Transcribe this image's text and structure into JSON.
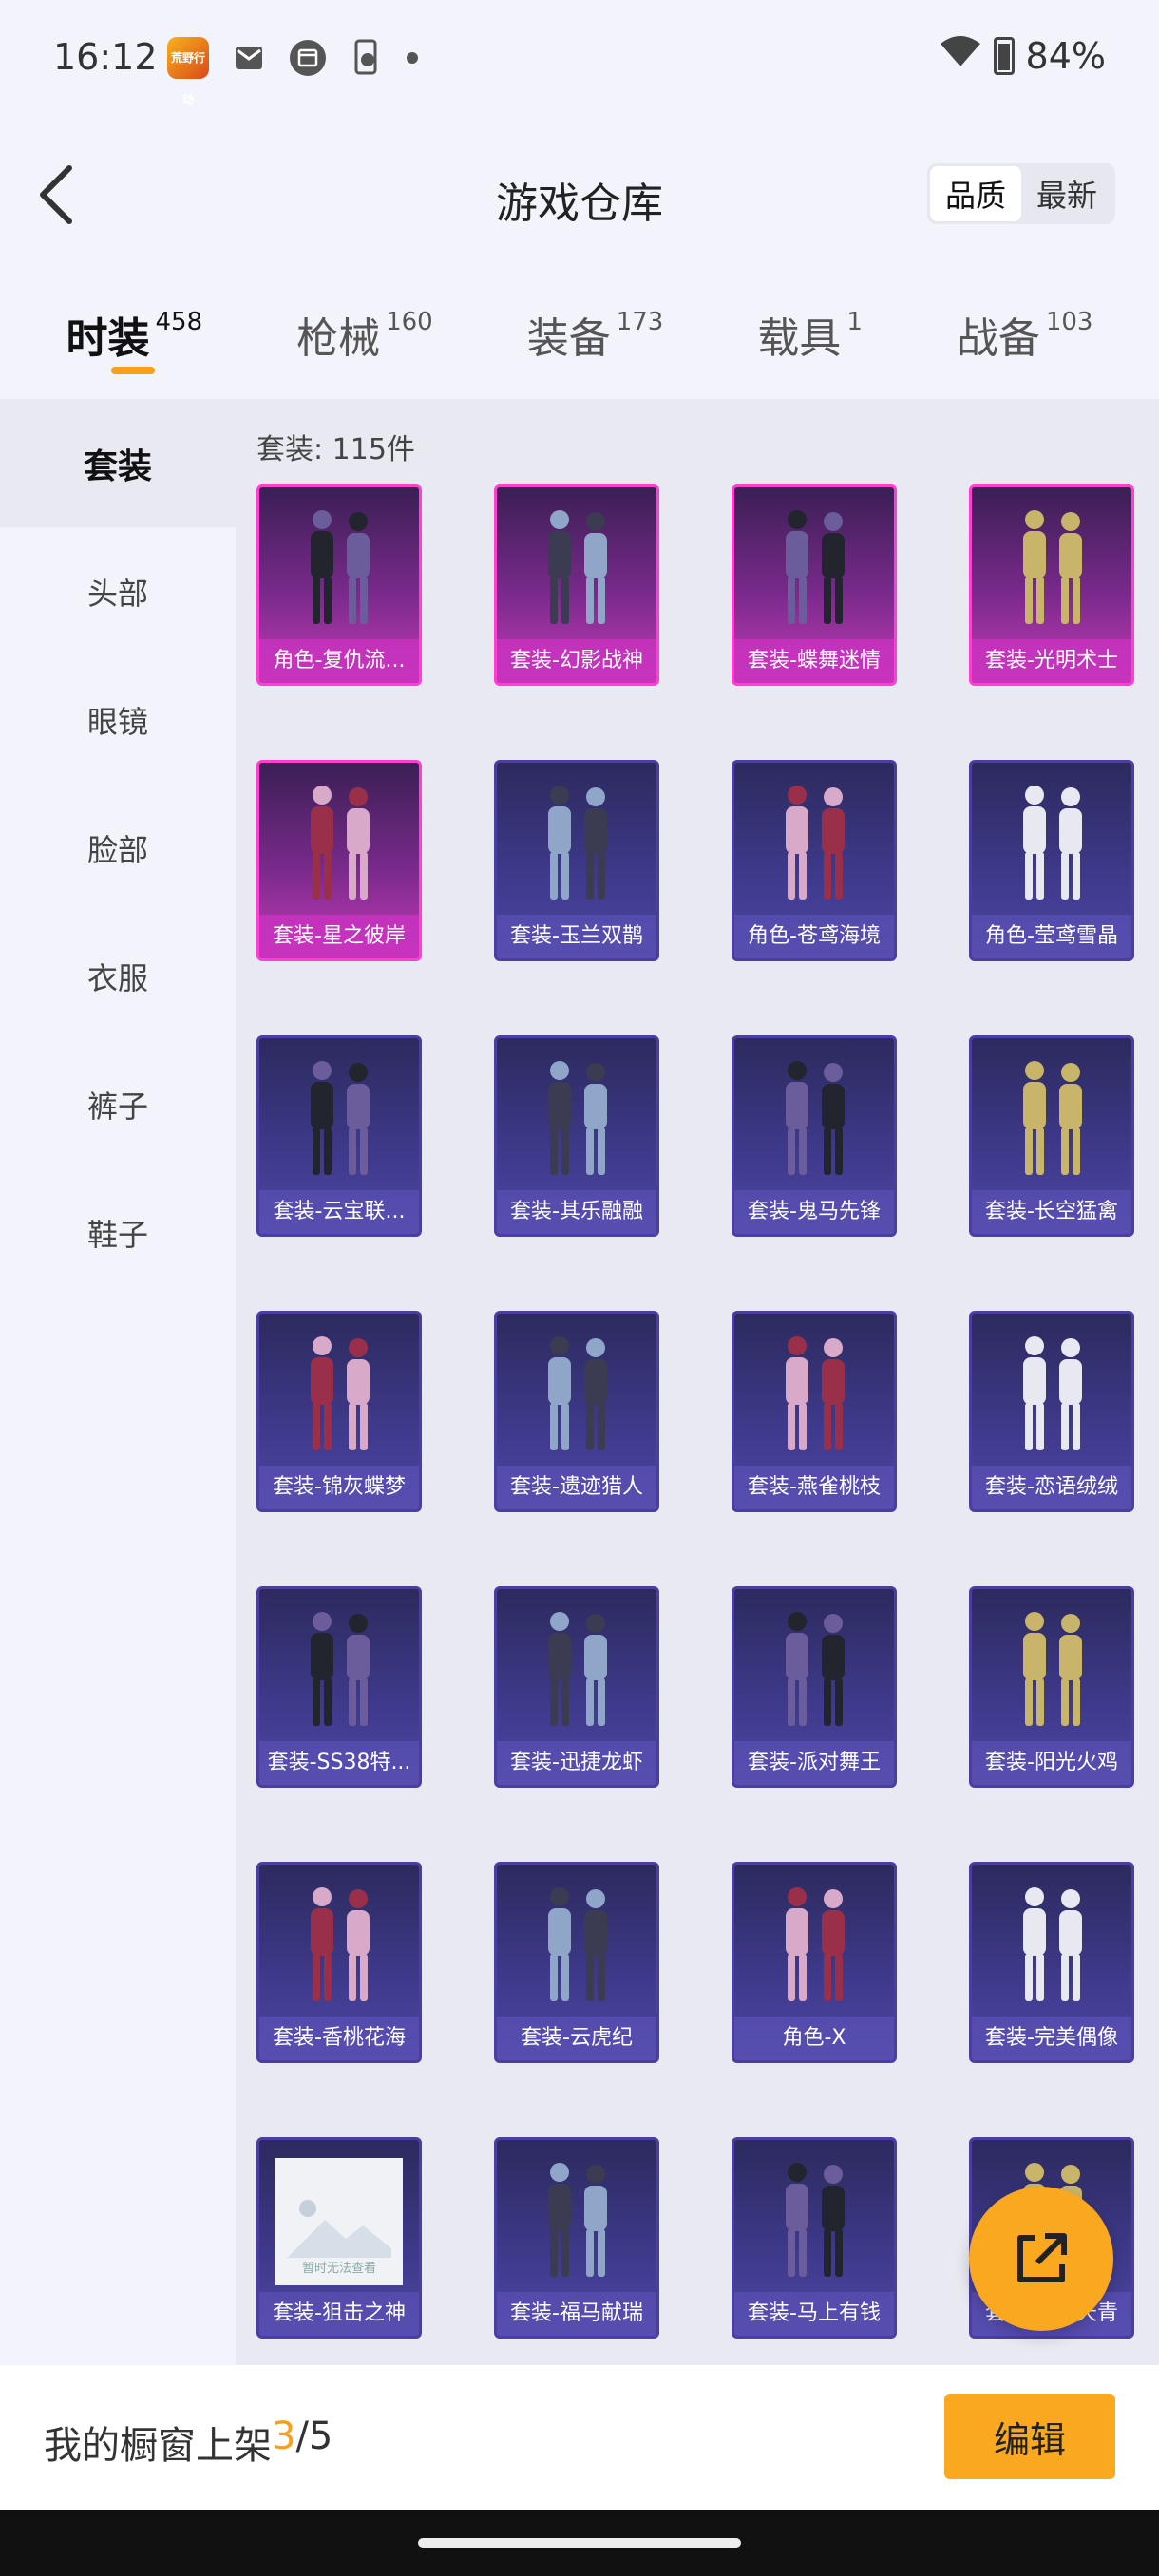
{
  "status_bar": {
    "time": "16:12",
    "battery": "84%",
    "app_icon_text": "荒野行动"
  },
  "header": {
    "title": "游戏仓库",
    "sort_options": [
      "品质",
      "最新"
    ],
    "active_sort": "品质"
  },
  "tabs": [
    {
      "label": "时装",
      "count": "458"
    },
    {
      "label": "枪械",
      "count": "160"
    },
    {
      "label": "装备",
      "count": "173"
    },
    {
      "label": "载具",
      "count": "1"
    },
    {
      "label": "战备",
      "count": "103"
    }
  ],
  "sidebar": {
    "items": [
      "套装",
      "头部",
      "眼镜",
      "脸部",
      "衣服",
      "裤子",
      "鞋子"
    ]
  },
  "section": {
    "label": "套装: 115件"
  },
  "items": [
    {
      "name": "角色-复仇流...",
      "rarity": "rare"
    },
    {
      "name": "套装-幻影战神",
      "rarity": "rare"
    },
    {
      "name": "套装-蝶舞迷情",
      "rarity": "rare"
    },
    {
      "name": "套装-光明术士",
      "rarity": "rare"
    },
    {
      "name": "套装-星之彼岸",
      "rarity": "rare"
    },
    {
      "name": "套装-玉兰双鹊",
      "rarity": "normal"
    },
    {
      "name": "角色-苍鸢海境",
      "rarity": "normal"
    },
    {
      "name": "角色-莹鸢雪晶",
      "rarity": "normal"
    },
    {
      "name": "套装-云宝联...",
      "rarity": "normal"
    },
    {
      "name": "套装-其乐融融",
      "rarity": "normal"
    },
    {
      "name": "套装-鬼马先锋",
      "rarity": "normal"
    },
    {
      "name": "套装-长空猛禽",
      "rarity": "normal"
    },
    {
      "name": "套装-锦灰蝶梦",
      "rarity": "normal"
    },
    {
      "name": "套装-遗迹猎人",
      "rarity": "normal"
    },
    {
      "name": "套装-燕雀桃枝",
      "rarity": "normal"
    },
    {
      "name": "套装-恋语绒绒",
      "rarity": "normal"
    },
    {
      "name": "套装-SS38特...",
      "rarity": "normal"
    },
    {
      "name": "套装-迅捷龙虾",
      "rarity": "normal"
    },
    {
      "name": "套装-派对舞王",
      "rarity": "normal"
    },
    {
      "name": "套装-阳光火鸡",
      "rarity": "normal"
    },
    {
      "name": "套装-香桃花海",
      "rarity": "normal"
    },
    {
      "name": "套装-云虎纪",
      "rarity": "normal"
    },
    {
      "name": "角色-X",
      "rarity": "normal"
    },
    {
      "name": "套装-完美偶像",
      "rarity": "normal"
    },
    {
      "name": "套装-狙击之神",
      "rarity": "normal",
      "placeholder": "暂时无法查看"
    },
    {
      "name": "套装-福马献瑞",
      "rarity": "normal"
    },
    {
      "name": "套装-马上有钱",
      "rarity": "normal"
    },
    {
      "name": "套装-雨过天青",
      "rarity": "normal"
    }
  ],
  "bottom_bar": {
    "label": "我的橱窗上架 ",
    "count": "3",
    "total": "/5",
    "edit_label": "编辑"
  },
  "colors": {
    "accent": "#f9a81f",
    "rare_border": "#ff3fd1",
    "normal_border": "#4b3ea0"
  }
}
